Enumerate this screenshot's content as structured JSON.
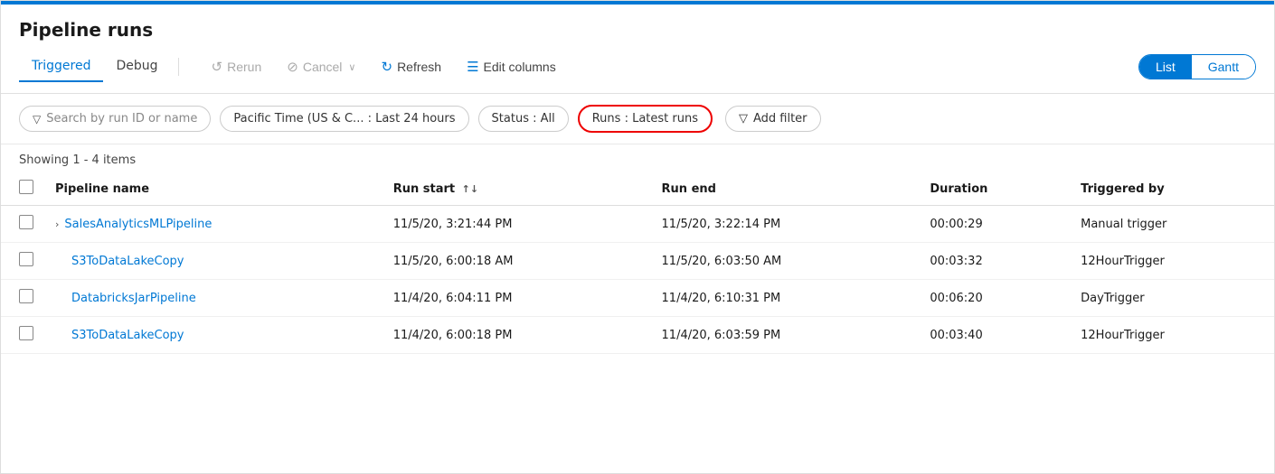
{
  "page": {
    "title": "Pipeline runs",
    "top_bar_color": "#0078d4"
  },
  "tabs": [
    {
      "id": "triggered",
      "label": "Triggered",
      "active": true
    },
    {
      "id": "debug",
      "label": "Debug",
      "active": false
    }
  ],
  "toolbar": {
    "rerun_label": "Rerun",
    "cancel_label": "Cancel",
    "refresh_label": "Refresh",
    "edit_columns_label": "Edit columns"
  },
  "view_toggle": {
    "list_label": "List",
    "gantt_label": "Gantt",
    "active": "List"
  },
  "filters": {
    "search_placeholder": "Search by run ID or name",
    "time_filter": "Pacific Time (US & C... : Last 24 hours",
    "status_filter": "Status : All",
    "runs_filter": "Runs : Latest runs",
    "add_filter_label": "Add filter"
  },
  "showing_text": "Showing 1 - 4 items",
  "table": {
    "columns": [
      {
        "id": "pipeline_name",
        "label": "Pipeline name"
      },
      {
        "id": "run_start",
        "label": "Run start",
        "sortable": true
      },
      {
        "id": "run_end",
        "label": "Run end"
      },
      {
        "id": "duration",
        "label": "Duration"
      },
      {
        "id": "triggered_by",
        "label": "Triggered by"
      }
    ],
    "rows": [
      {
        "id": 1,
        "pipeline_name": "SalesAnalyticsMLPipeline",
        "has_expand": true,
        "run_start": "11/5/20, 3:21:44 PM",
        "run_end": "11/5/20, 3:22:14 PM",
        "duration": "00:00:29",
        "triggered_by": "Manual trigger"
      },
      {
        "id": 2,
        "pipeline_name": "S3ToDataLakeCopy",
        "has_expand": false,
        "run_start": "11/5/20, 6:00:18 AM",
        "run_end": "11/5/20, 6:03:50 AM",
        "duration": "00:03:32",
        "triggered_by": "12HourTrigger"
      },
      {
        "id": 3,
        "pipeline_name": "DatabricksJarPipeline",
        "has_expand": false,
        "run_start": "11/4/20, 6:04:11 PM",
        "run_end": "11/4/20, 6:10:31 PM",
        "duration": "00:06:20",
        "triggered_by": "DayTrigger"
      },
      {
        "id": 4,
        "pipeline_name": "S3ToDataLakeCopy",
        "has_expand": false,
        "run_start": "11/4/20, 6:00:18 PM",
        "run_end": "11/4/20, 6:03:59 PM",
        "duration": "00:03:40",
        "triggered_by": "12HourTrigger"
      }
    ]
  }
}
